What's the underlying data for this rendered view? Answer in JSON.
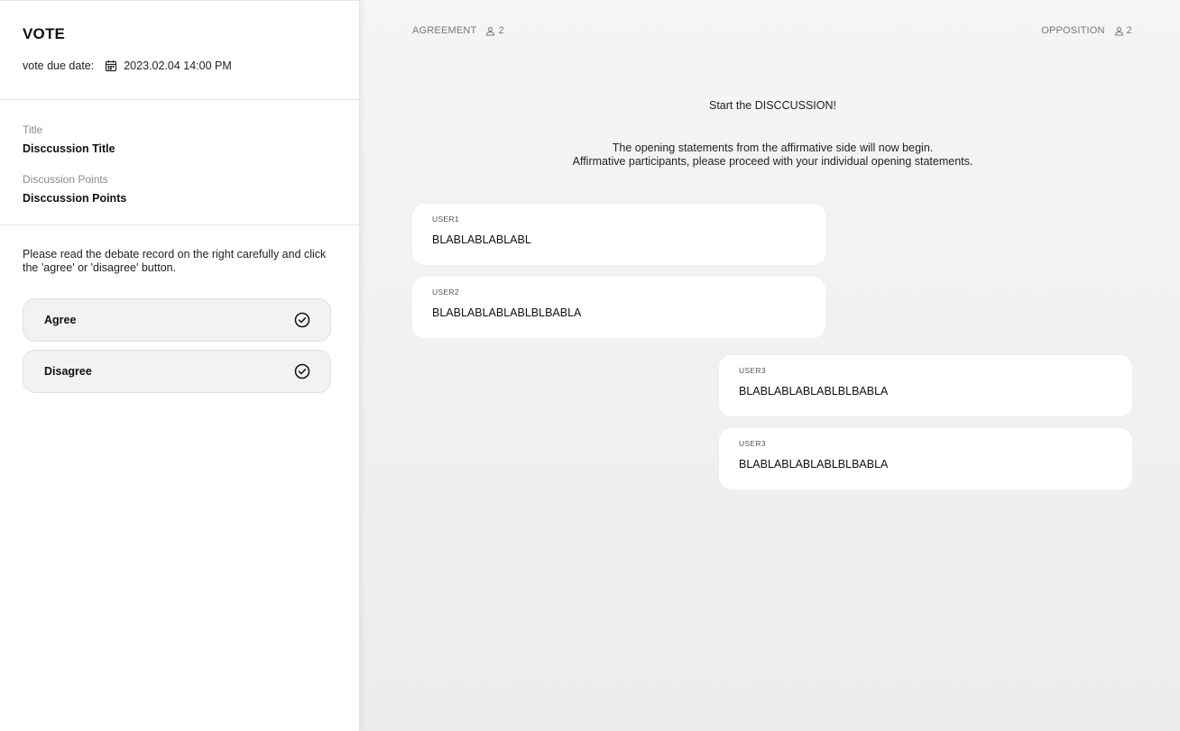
{
  "sidebar": {
    "title": "VOTE",
    "due_label": "vote due date:",
    "due_value": "2023.02.04 14:00 PM",
    "title_label": "Title",
    "title_value": "Disccussion Title",
    "points_label": "Discussion Points",
    "points_value": "Disccussion Points",
    "instruction": "Please read the debate record on the right carefully and click the 'agree' or 'disagree' button.",
    "agree_label": "Agree",
    "disagree_label": "Disagree"
  },
  "main": {
    "agreement_label": "AGREEMENT",
    "agreement_count": "2",
    "opposition_label": "OPPOSITION",
    "opposition_count": "2",
    "start_title": "Start the DISCCUSSION!",
    "opening_line1": "The opening statements from the affirmative side will now begin.",
    "opening_line2": "Affirmative participants, please proceed with your individual opening statements.",
    "messages": [
      {
        "user": "USER1",
        "text": "BLABLABLABLABL",
        "side": "agreement"
      },
      {
        "user": "USER2",
        "text": "BLABLABLABLABLBLBABLA",
        "side": "agreement"
      },
      {
        "user": "USER3",
        "text": "BLABLABLABLABLBLBABLA",
        "side": "opposition"
      },
      {
        "user": "USER3",
        "text": "BLABLABLABLABLBLBABLA",
        "side": "opposition"
      }
    ]
  },
  "icons": {
    "calendar": "calendar-icon",
    "check": "check-circle-icon",
    "person": "person-icon"
  }
}
